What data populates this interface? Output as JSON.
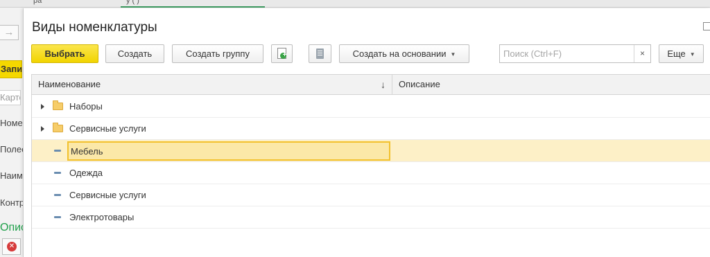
{
  "background": {
    "tab1": "                 ра",
    "tab2": "                   у (                  )",
    "save_label": "Записать",
    "field_value": "Карточка",
    "labels": [
      "Номен",
      "Полее на",
      "Наимено",
      "Контр ул:"
    ],
    "green_text": "Описани"
  },
  "form": {
    "title": "Виды номенклатуры",
    "toolbar": {
      "select_label": "Выбрать",
      "create_label": "Создать",
      "create_group_label": "Создать группу",
      "create_based_on_label": "Создать на основании",
      "more_label": "Еще",
      "search_placeholder": "Поиск (Ctrl+F)",
      "clear_label": "×"
    },
    "grid": {
      "columns": [
        "Наименование",
        "Описание"
      ],
      "sort_indicator": "↓",
      "rows": [
        {
          "kind": "group",
          "name": "Наборы",
          "description": ""
        },
        {
          "kind": "group",
          "name": "Сервисные услуги",
          "description": ""
        },
        {
          "kind": "item",
          "name": "Мебель",
          "description": "",
          "selected": true
        },
        {
          "kind": "item",
          "name": "Одежда",
          "description": ""
        },
        {
          "kind": "item",
          "name": "Сервисные услуги",
          "description": ""
        },
        {
          "kind": "item",
          "name": "Электротовары",
          "description": ""
        }
      ]
    }
  },
  "colors": {
    "primary_button": "#f1d400",
    "selected_row": "#fdf0c7",
    "focus_border": "#f2c12e",
    "folder": "#f6cd6a",
    "item_marker": "#6a8db0",
    "green_link": "#1fa04a",
    "close_icon": "#d63b3b"
  },
  "icons": {
    "add_copy": "add-copy-icon",
    "list": "document-list-icon",
    "folder": "folder-icon",
    "item": "item-dash-icon"
  }
}
